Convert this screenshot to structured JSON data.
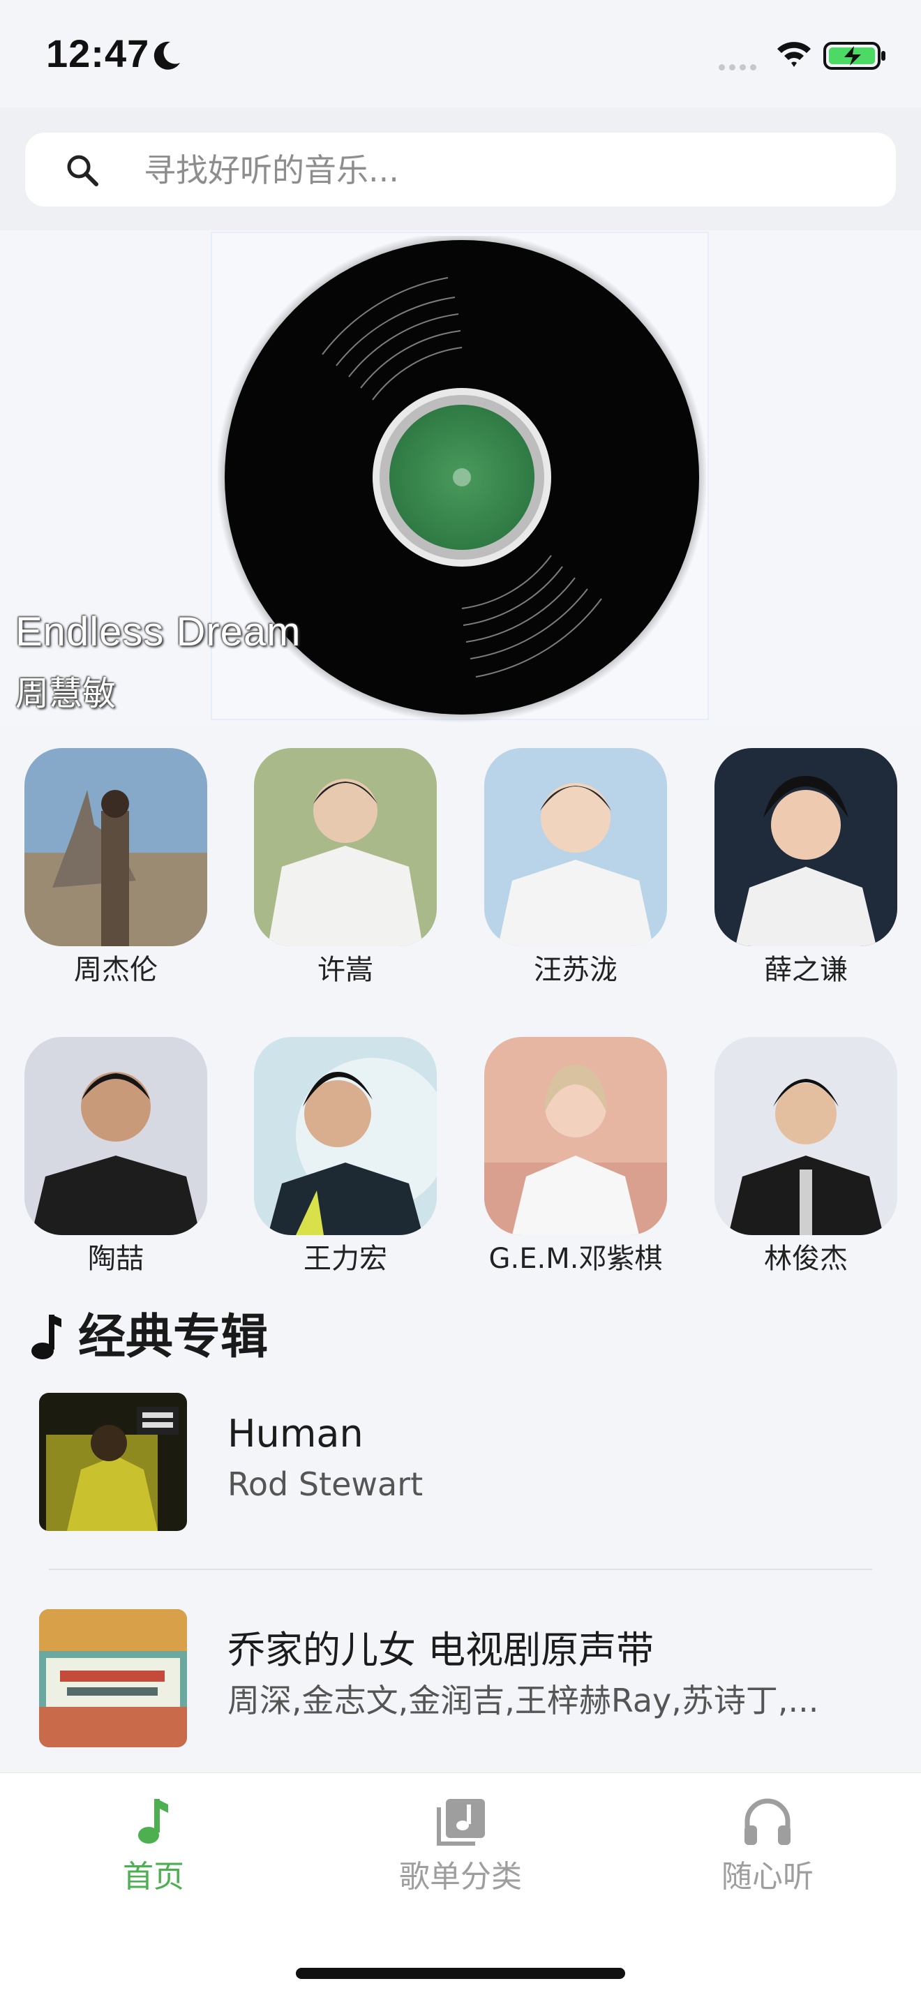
{
  "status_bar": {
    "time": "12:47",
    "moon_icon": "moon-icon",
    "signal_icon": "signal-dots-icon",
    "wifi_icon": "wifi-icon",
    "battery_icon": "battery-charging-icon"
  },
  "search": {
    "placeholder": "寻找好听的音乐..."
  },
  "hero": {
    "title": "Endless Dream",
    "artist": "周慧敏",
    "center_color": "#3c8a4f"
  },
  "artists": [
    {
      "name": "周杰伦"
    },
    {
      "name": "许嵩"
    },
    {
      "name": "汪苏泷"
    },
    {
      "name": "薛之谦"
    },
    {
      "name": "陶喆"
    },
    {
      "name": "王力宏"
    },
    {
      "name": "G.E.M.邓紫棋"
    },
    {
      "name": "林俊杰"
    }
  ],
  "section": {
    "title": "经典专辑",
    "icon": "music-note-icon"
  },
  "albums": [
    {
      "title": "Human",
      "artists": "Rod Stewart"
    },
    {
      "title": "乔家的儿女 电视剧原声带",
      "artists": "周深,金志文,金润吉,王梓赫Ray,苏诗丁,..."
    }
  ],
  "tabs": [
    {
      "label": "首页",
      "icon": "music-note-icon",
      "active": true
    },
    {
      "label": "歌单分类",
      "icon": "album-library-icon",
      "active": false
    },
    {
      "label": "随心听",
      "icon": "headphones-icon",
      "active": false
    }
  ],
  "colors": {
    "accent": "#4caf50",
    "inactive": "#9e9e9e",
    "background": "#f3f5f8"
  }
}
